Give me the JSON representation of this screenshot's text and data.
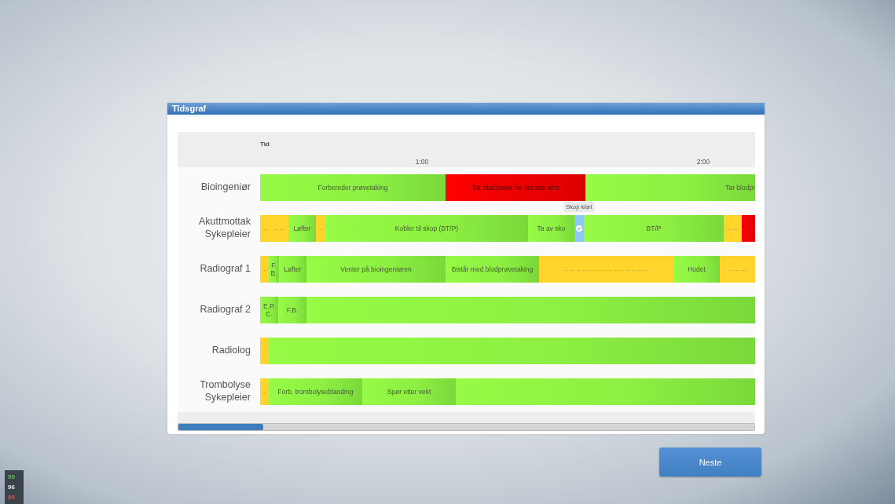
{
  "window": {
    "title": "Tidsgraf"
  },
  "timeline": {
    "axis_label": "Tid",
    "ticks": [
      "1:00",
      "2:00"
    ],
    "rows": [
      {
        "label": "Bioingeniør",
        "segments": [
          {
            "kind": "task",
            "text": "Forbereder prøvetaking"
          },
          {
            "kind": "error",
            "text": "Tar blodprøve fra venstre arm"
          },
          {
            "kind": "task",
            "text": "Tar blodpr"
          }
        ]
      },
      {
        "label": "Akuttmottak Sykepleier",
        "segments": [
          {
            "kind": "wait",
            "text": "..."
          },
          {
            "kind": "wait",
            "text": "... ..."
          },
          {
            "kind": "task",
            "text": "Løfter"
          },
          {
            "kind": "wait",
            "text": "..."
          },
          {
            "kind": "task",
            "text": "Kobler til skop (BT/P)"
          },
          {
            "kind": "task",
            "text": "Ta av sko"
          },
          {
            "kind": "marker",
            "tooltip": "Skop klart"
          },
          {
            "kind": "task",
            "text": "BT/P"
          },
          {
            "kind": "wait",
            "text": "... ..."
          },
          {
            "kind": "error"
          }
        ]
      },
      {
        "label": "Radiograf 1",
        "segments": [
          {
            "kind": "wait",
            "text": "..."
          },
          {
            "kind": "task",
            "text": "F. B."
          },
          {
            "kind": "task",
            "text": "Løfter"
          },
          {
            "kind": "task",
            "text": "Venter på bioingeniøren"
          },
          {
            "kind": "task",
            "text": "Bistår med blodprøvetaking"
          },
          {
            "kind": "wait",
            "text": "... ... ... ... ... ... ... ... ... ... ... ... ... ..."
          },
          {
            "kind": "task",
            "text": "Hodet"
          },
          {
            "kind": "wait",
            "text": "... ... ..."
          }
        ]
      },
      {
        "label": "Radiograf 2",
        "segments": [
          {
            "kind": "task",
            "text": "E.P. C."
          },
          {
            "kind": "task",
            "text": "F.B."
          },
          {
            "kind": "task"
          }
        ]
      },
      {
        "label": "Radiolog",
        "segments": [
          {
            "kind": "wait",
            "text": "..."
          },
          {
            "kind": "task"
          }
        ]
      },
      {
        "label": "Trombolyse Sykepleier",
        "segments": [
          {
            "kind": "wait",
            "text": "..."
          },
          {
            "kind": "task",
            "text": "Forb. trombolyseblanding"
          },
          {
            "kind": "task",
            "text": "Spør etter vekt"
          },
          {
            "kind": "task"
          }
        ]
      }
    ]
  },
  "buttons": [
    {
      "label": "Neste"
    }
  ],
  "fps_counter": [
    {
      "value": "99",
      "color": "#5cc43a"
    },
    {
      "value": "96",
      "color": "#e8e8e8"
    },
    {
      "value": "85",
      "color": "#ff4040"
    }
  ]
}
